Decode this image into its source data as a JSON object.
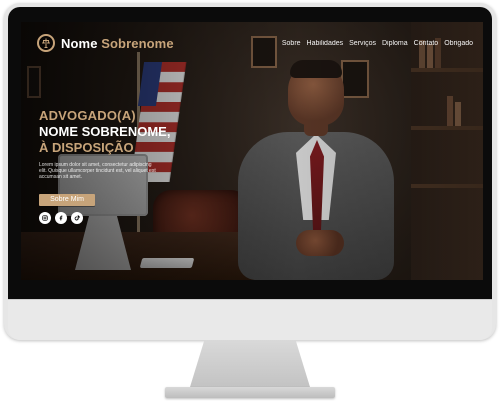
{
  "header": {
    "brand": {
      "first": "Nome",
      "last": "Sobrenome"
    },
    "nav": [
      {
        "label": "Sobre"
      },
      {
        "label": "Habilidades"
      },
      {
        "label": "Serviços"
      },
      {
        "label": "Diploma"
      },
      {
        "label": "Contato"
      },
      {
        "label": "Obrigado"
      }
    ]
  },
  "hero": {
    "kicker": "ADVOGADO(A)",
    "title": "NOME SOBRENOME,",
    "subtitle": "À DISPOSIÇÃO",
    "description": "Lorem ipsum dolor sit amet, consectetur adipiscing elit. Quisque ullamcorper tincidunt est, vel aliquet est accumsan sit amet.",
    "cta_label": "Sobre Mim",
    "social": [
      {
        "icon": "instagram-icon"
      },
      {
        "icon": "facebook-icon"
      },
      {
        "icon": "tiktok-icon"
      }
    ]
  },
  "colors": {
    "accent": "#c7a47a",
    "text": "#ffffff",
    "monitor_frame": "#0b0b0b",
    "monitor_body": "#e6e6e6"
  }
}
